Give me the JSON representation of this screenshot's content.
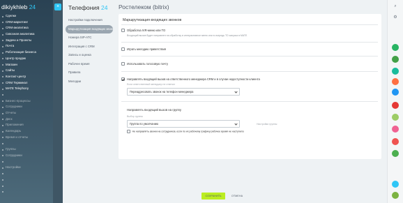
{
  "portal": {
    "name": "dikiykhleb",
    "version": "24",
    "menu": [
      {
        "label": "Сделки",
        "badge": "",
        "dim": false
      },
      {
        "label": "CRM-маркетинг",
        "badge": "",
        "dim": false
      },
      {
        "label": "CRM-аналитика",
        "badge": "",
        "dim": false
      },
      {
        "label": "Сквозная аналитика",
        "badge": "",
        "dim": false
      },
      {
        "label": "Задачи и Проекты",
        "badge": "",
        "dim": false
      },
      {
        "label": "Почта",
        "badge": "",
        "dim": false
      },
      {
        "label": "Роботизация бизнеса",
        "badge": "",
        "dim": false
      },
      {
        "label": "Центр продаж",
        "badge": "",
        "dim": false
      },
      {
        "label": "Магазин",
        "badge": "",
        "dim": false
      },
      {
        "label": "Сайты",
        "badge": "",
        "dim": false
      },
      {
        "label": "Контакт-центр",
        "badge": "",
        "dim": false
      },
      {
        "label": "CRM Терминал",
        "badge": "",
        "dim": false
      },
      {
        "label": "MATE Telephony",
        "badge": "",
        "dim": false
      },
      {
        "label": "",
        "badge": "",
        "dim": true
      },
      {
        "label": "Бизнес-процессы",
        "badge": "",
        "dim": true
      },
      {
        "label": "Сотрудники",
        "badge": "",
        "dim": true
      },
      {
        "label": "Отчеты",
        "badge": "",
        "dim": true
      },
      {
        "label": "Диск",
        "badge": "",
        "dim": true
      },
      {
        "label": "Приложения",
        "badge": "",
        "dim": true
      },
      {
        "label": "Календарь",
        "badge": "",
        "dim": true
      },
      {
        "label": "Время и отчеты",
        "badge": "",
        "dim": true
      },
      {
        "label": "",
        "badge": "",
        "dim": true
      },
      {
        "label": "Группы",
        "badge": "",
        "dim": true
      },
      {
        "label": "Сотрудники",
        "badge": "",
        "dim": true
      },
      {
        "label": "",
        "badge": "",
        "dim": true
      },
      {
        "label": "Настройки",
        "badge": "",
        "dim": true
      },
      {
        "label": "",
        "badge": "",
        "dim": true
      },
      {
        "label": "",
        "badge": "",
        "dim": true
      },
      {
        "label": "",
        "badge": "",
        "dim": true
      },
      {
        "label": "",
        "badge": "",
        "dim": true
      }
    ]
  },
  "close_icon": "×",
  "telephony": {
    "title": "Телефония",
    "title_num": "24",
    "menu": [
      {
        "label": "Настройки подключения",
        "active": false
      },
      {
        "label": "Маршрутизация входящих звонков",
        "active": true
      },
      {
        "label": "Номера SIP-АТС",
        "active": false
      },
      {
        "label": "Интеграция с CRM",
        "active": false
      },
      {
        "label": "Запись и оценка",
        "active": false
      },
      {
        "label": "Рабочее время",
        "active": false
      },
      {
        "label": "Правила",
        "active": false
      },
      {
        "label": "Мелодии",
        "active": false
      }
    ]
  },
  "page": {
    "heading": "Ростелеком (bitrix)",
    "section_title": "Маршрутизация входящих звонков",
    "option_ivr": "Обработка IVR-меню или ТО",
    "hint_ivr": "Входящий вызов будет направлен на обработку в интерактивное меню или в очередь ТО запуска в МАТЕ",
    "option_melody": "Играть мелодию приветствия",
    "option_voicemail": "Использовать голосовую почту",
    "option_crm": "Направлять входящий вызов на ответственного менеджера CRM и в случае недоступности клиента",
    "crm_label": "Если ответственный менеджер не ответил",
    "crm_select": "Переадресовать звонок на телефон менеджера",
    "group_section": "Направлять входящий вызов на группу",
    "group_label": "Выбор группы",
    "group_select": "Группа по умолчанию",
    "group_edit": "Настройки группы",
    "option_worktime": "Не направлять звонки на сотрудников, если по их рабочему графику рабочее время не наступило"
  },
  "buttons": {
    "save": "СОХРАНИТЬ",
    "cancel": "ОТМЕНА"
  },
  "colors": {
    "accent": "#2fc6f6",
    "save_bg": "#bbed21",
    "sidebar": "#2a4253"
  },
  "messenger_icons": [
    {
      "name": "search-icon",
      "color": ""
    },
    {
      "name": "settings-icon",
      "color": ""
    },
    {
      "name": "chat-icon-1",
      "color": "#28b463"
    },
    {
      "name": "chat-icon-2",
      "color": "#43a047"
    },
    {
      "name": "chat-icon-3",
      "color": "#1abc9c"
    },
    {
      "name": "chat-icon-4",
      "color": "#ff7043"
    },
    {
      "name": "chat-icon-5",
      "color": "#2196f3"
    },
    {
      "name": "chat-icon-6",
      "color": "#e53935"
    },
    {
      "name": "chat-icon-7",
      "color": "#9ccc65"
    },
    {
      "name": "chat-icon-8",
      "color": "#f06292"
    },
    {
      "name": "chat-icon-9",
      "color": "#ef5350"
    },
    {
      "name": "chat-icon-10",
      "color": "#4caf50"
    },
    {
      "name": "chat-icon-11",
      "color": "#2fc6f6"
    },
    {
      "name": "chat-icon-12",
      "color": "#7cb342"
    }
  ]
}
